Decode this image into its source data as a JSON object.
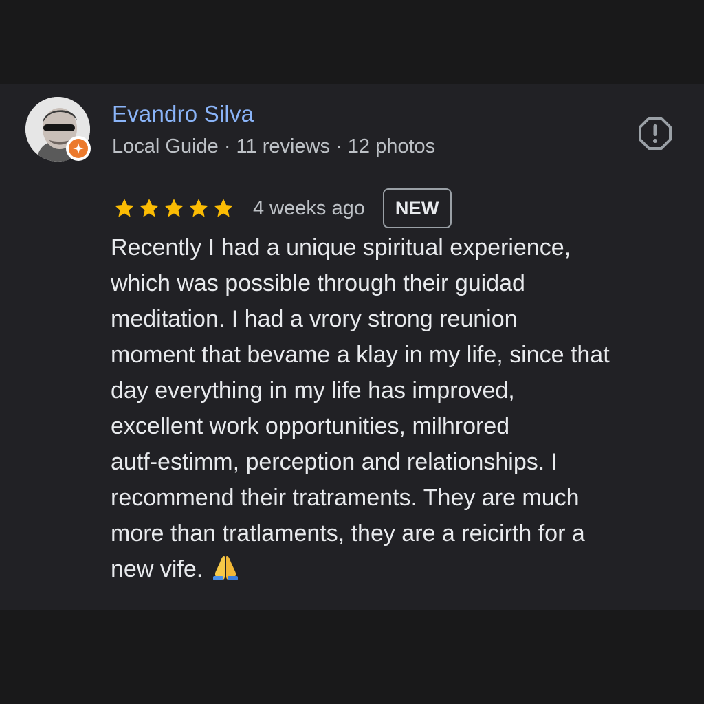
{
  "review": {
    "reviewer_name": "Evandro Silva",
    "reviewer_meta": "Local Guide · 11 reviews · 12 photos",
    "rating": 5,
    "rating_max": 5,
    "date": "4 weeks ago",
    "badge": "NEW",
    "text_lines": [
      "Recently I had a unique spiritual experience,",
      "which was possible through their guidad",
      "meditation. I had a vrory strong reunion",
      "moment that bevame a klay in my life, since that",
      "day everything in my life has improved,",
      "excellent work opportunities, milhrored",
      "autf-estimm, perception and relationships. I",
      "recommend their tratraments. They are much",
      "more than tratlaments, they are a reicirth for a",
      "new vife."
    ],
    "end_emoji": "folded-hands-icon"
  },
  "colors": {
    "background": "#19191a",
    "card": "#212125",
    "name": "#8ab4f8",
    "meta": "#bdc1c6",
    "text": "#e8eaed",
    "star": "#fbbc04",
    "badge_border": "#9aa0a6",
    "local_guide_badge": "#ec7a2d"
  },
  "icons": {
    "avatar": "avatar",
    "local_guide": "local-guide-badge-icon",
    "report": "report-flag-icon",
    "star": "star-icon"
  }
}
